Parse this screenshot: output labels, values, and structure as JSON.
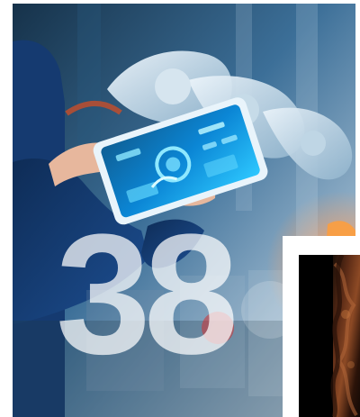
{
  "hero": {
    "number": "38"
  },
  "colors": {
    "accent": "#18b8ff",
    "background": "#ffffff"
  },
  "icons": {
    "photo": "industrial-tablet-robot-photo",
    "inset": "dark-copper-texture-image"
  }
}
